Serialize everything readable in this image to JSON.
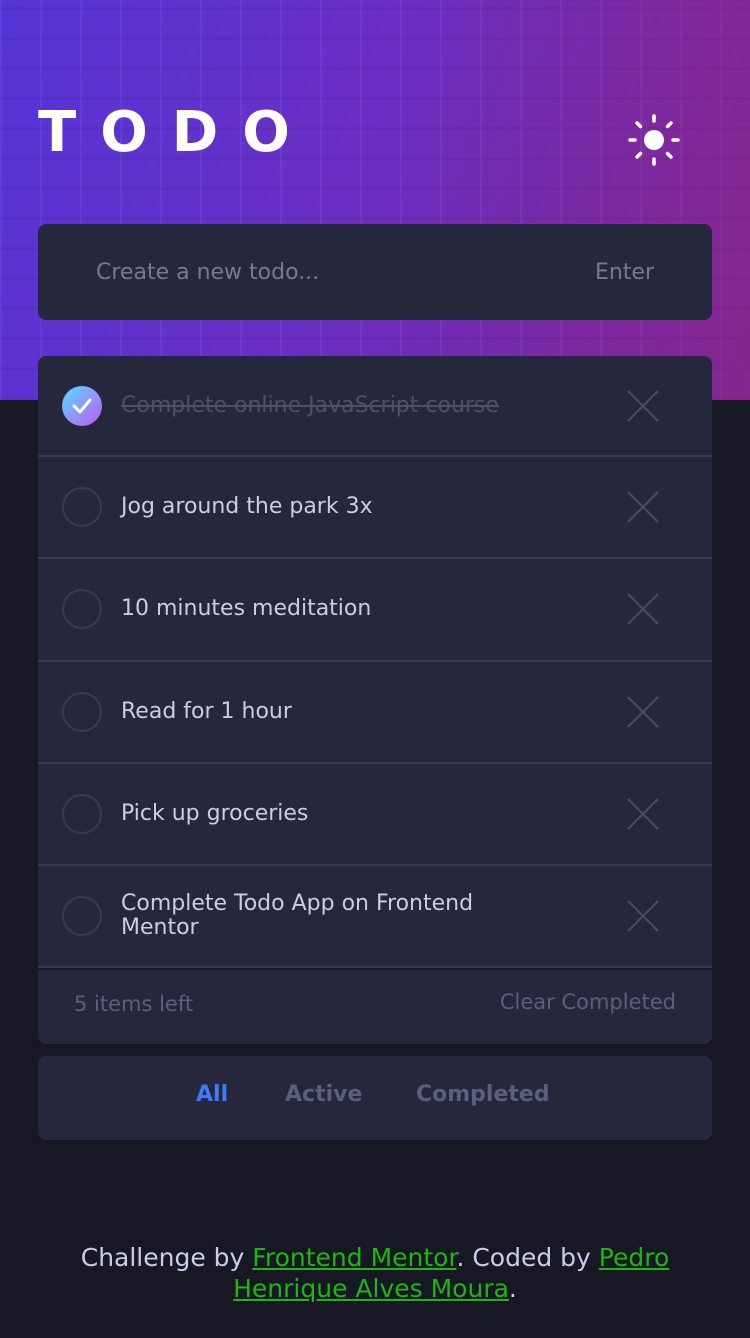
{
  "header": {
    "title": "TODO",
    "theme_toggle_icon": "sun-icon"
  },
  "new_todo": {
    "placeholder": "Create a new todo...",
    "value": "",
    "submit_label": "Enter"
  },
  "todos": [
    {
      "text": "Complete online JavaScript course",
      "completed": true
    },
    {
      "text": "Jog around the park 3x",
      "completed": false
    },
    {
      "text": "10 minutes meditation",
      "completed": false
    },
    {
      "text": "Read for 1 hour",
      "completed": false
    },
    {
      "text": "Pick up groceries",
      "completed": false
    },
    {
      "text": "Complete Todo App on Frontend Mentor",
      "completed": false
    }
  ],
  "footer": {
    "items_left": "5 items left",
    "clear_label": "Clear Completed"
  },
  "filters": {
    "all": "All",
    "active": "Active",
    "completed": "Completed",
    "selected": "All"
  },
  "attribution": {
    "prefix": "Challenge by",
    "link1": "Frontend Mentor",
    "middle": ". Coded by",
    "link2": "Pedro Henrique Alves Moura",
    "suffix": "."
  },
  "colors": {
    "accent": "#3a7cfd",
    "check_gradient_start": "#57ddff",
    "check_gradient_end": "#c058f3",
    "link": "#1fb512",
    "card_bg": "#25273c",
    "page_bg": "#171824"
  }
}
